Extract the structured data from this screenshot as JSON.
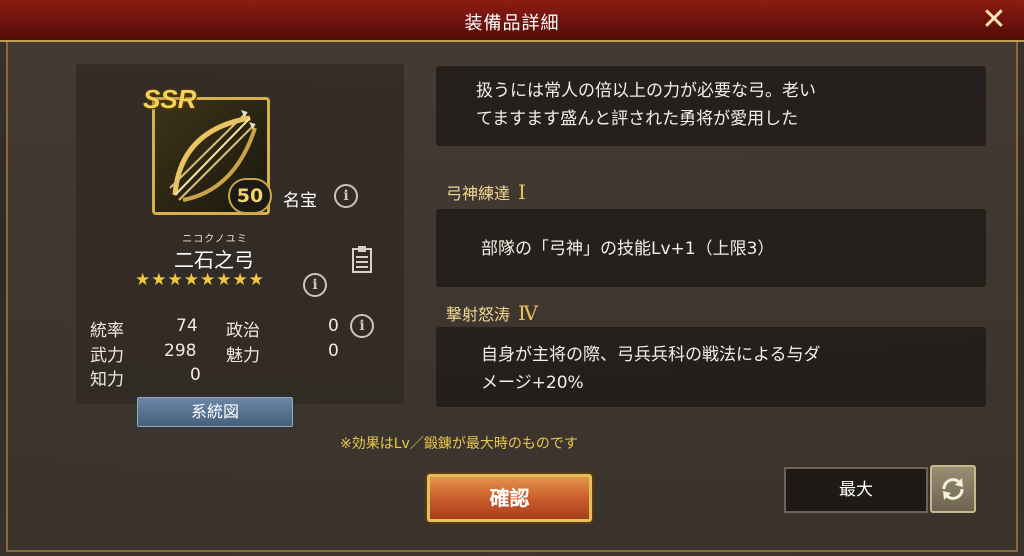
{
  "window": {
    "title": "装備品詳細"
  },
  "item": {
    "rank_badge": "SSR",
    "level": "50",
    "rarity_label": "名宝",
    "furigana": "ニコクノユミ",
    "name": "二石之弓",
    "stars": "★★★★★★★★",
    "star_count": 8
  },
  "stats": [
    {
      "label": "統率",
      "value": "74"
    },
    {
      "label": "政治",
      "value": "0"
    },
    {
      "label": "武力",
      "value": "298"
    },
    {
      "label": "魅力",
      "value": "0"
    },
    {
      "label": "知力",
      "value": "0"
    }
  ],
  "buttons": {
    "lineage": "系統図",
    "confirm": "確認",
    "max": "最大"
  },
  "description": [
    "扱うには常人の倍以上の力が必要な弓。老い",
    "てますます盛んと評された勇将が愛用した"
  ],
  "skills": [
    {
      "name": "弓神練達",
      "rank": "Ⅰ",
      "text": [
        "部隊の「弓神」の技能Lv+1（上限3）"
      ]
    },
    {
      "name": "撃射怒涛",
      "rank": "Ⅳ",
      "text": [
        "自身が主将の際、弓兵兵科の戦法による与ダ",
        "メージ+20%"
      ]
    }
  ],
  "note": "※効果はLv／鍛錬が最大時のものです",
  "colors": {
    "title_bar": "#7a160f",
    "accent_gold": "#d6b04a",
    "confirm_orange": "#c7592a",
    "lineage_blue": "#5a7493"
  },
  "icons": [
    "close-icon",
    "info-icon",
    "clipboard-icon",
    "refresh-icon",
    "bow-icon"
  ]
}
